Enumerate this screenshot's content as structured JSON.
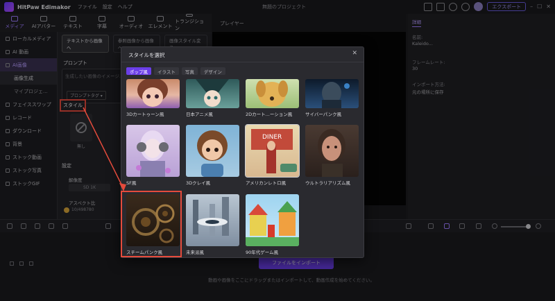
{
  "app": {
    "name": "HitPaw Edimakor",
    "menu": [
      "ファイル",
      "設定",
      "ヘルプ"
    ],
    "center_title": "無題のプロジェクト",
    "export_label": "エクスポート"
  },
  "toolbar": [
    {
      "label": "メディア",
      "active": true
    },
    {
      "label": "AIアバター"
    },
    {
      "label": "テキスト"
    },
    {
      "label": "字幕"
    },
    {
      "label": "オーディオ"
    },
    {
      "label": "エレメント"
    },
    {
      "label": "トランジション"
    }
  ],
  "sidebar": [
    {
      "label": "ローカルメディア"
    },
    {
      "label": "AI 動画"
    },
    {
      "label": "AI画像",
      "active": true
    },
    {
      "label": "画像生成",
      "sub": true,
      "active": true
    },
    {
      "label": "マイプロジェ...",
      "sub": true
    },
    {
      "label": "フェイススワップ"
    },
    {
      "label": "レコード"
    },
    {
      "label": "ダウンロード"
    },
    {
      "label": "背景"
    },
    {
      "label": "ストック動画"
    },
    {
      "label": "ストック写真"
    },
    {
      "label": "ストックGIF"
    }
  ],
  "panel": {
    "tabs": [
      "テキストから画像へ",
      "参照画像から画像へ",
      "画像スタイル変換"
    ],
    "prompt_label": "プロンプト",
    "prompt_placeholder": "生成したい画像のイメージ...",
    "prompt_tag": "プロンプトタグ ▾",
    "style_label": "スタイル",
    "none_label": "無し",
    "settings_label": "設定",
    "resolution_label": "解像度",
    "resolution_value": "SD 1K",
    "aspect_label": "アスペクト比",
    "credits": "10/498780"
  },
  "player": {
    "title": "プレイヤー"
  },
  "props": {
    "tab": "詳細",
    "rows": [
      {
        "key": "名前:",
        "value": "Kaleido..."
      },
      {
        "key": "フレームレート:",
        "value": "30"
      },
      {
        "key": "インポート方法:",
        "value": "元の場所に保存"
      }
    ]
  },
  "timeline": {
    "import_label": "ファイルをインポート",
    "drop_hint": "動画や画像をここにドラッグまたはインポートして、動画作成を始めてください。"
  },
  "modal": {
    "title": "スタイルを選択",
    "categories": [
      "ポップ風",
      "イラスト",
      "写真",
      "デザイン"
    ],
    "active_category": "ポップ風",
    "styles": [
      {
        "label": "3Dカートゥーン風"
      },
      {
        "label": "日本アニメ風"
      },
      {
        "label": "2Dカート...ーション風"
      },
      {
        "label": "サイバーパンク風"
      },
      {
        "label": "SF風"
      },
      {
        "label": "3Dクレイ風"
      },
      {
        "label": "アメリカンレトロ風"
      },
      {
        "label": "ウルトラリアリズム風"
      },
      {
        "label": "スチームパンク風"
      },
      {
        "label": "未来派風"
      },
      {
        "label": "90年代ゲーム風"
      }
    ]
  },
  "colors": {
    "accent": "#6b3ee8",
    "highlight": "#e54b3c",
    "bg": "#1c1c1f"
  }
}
